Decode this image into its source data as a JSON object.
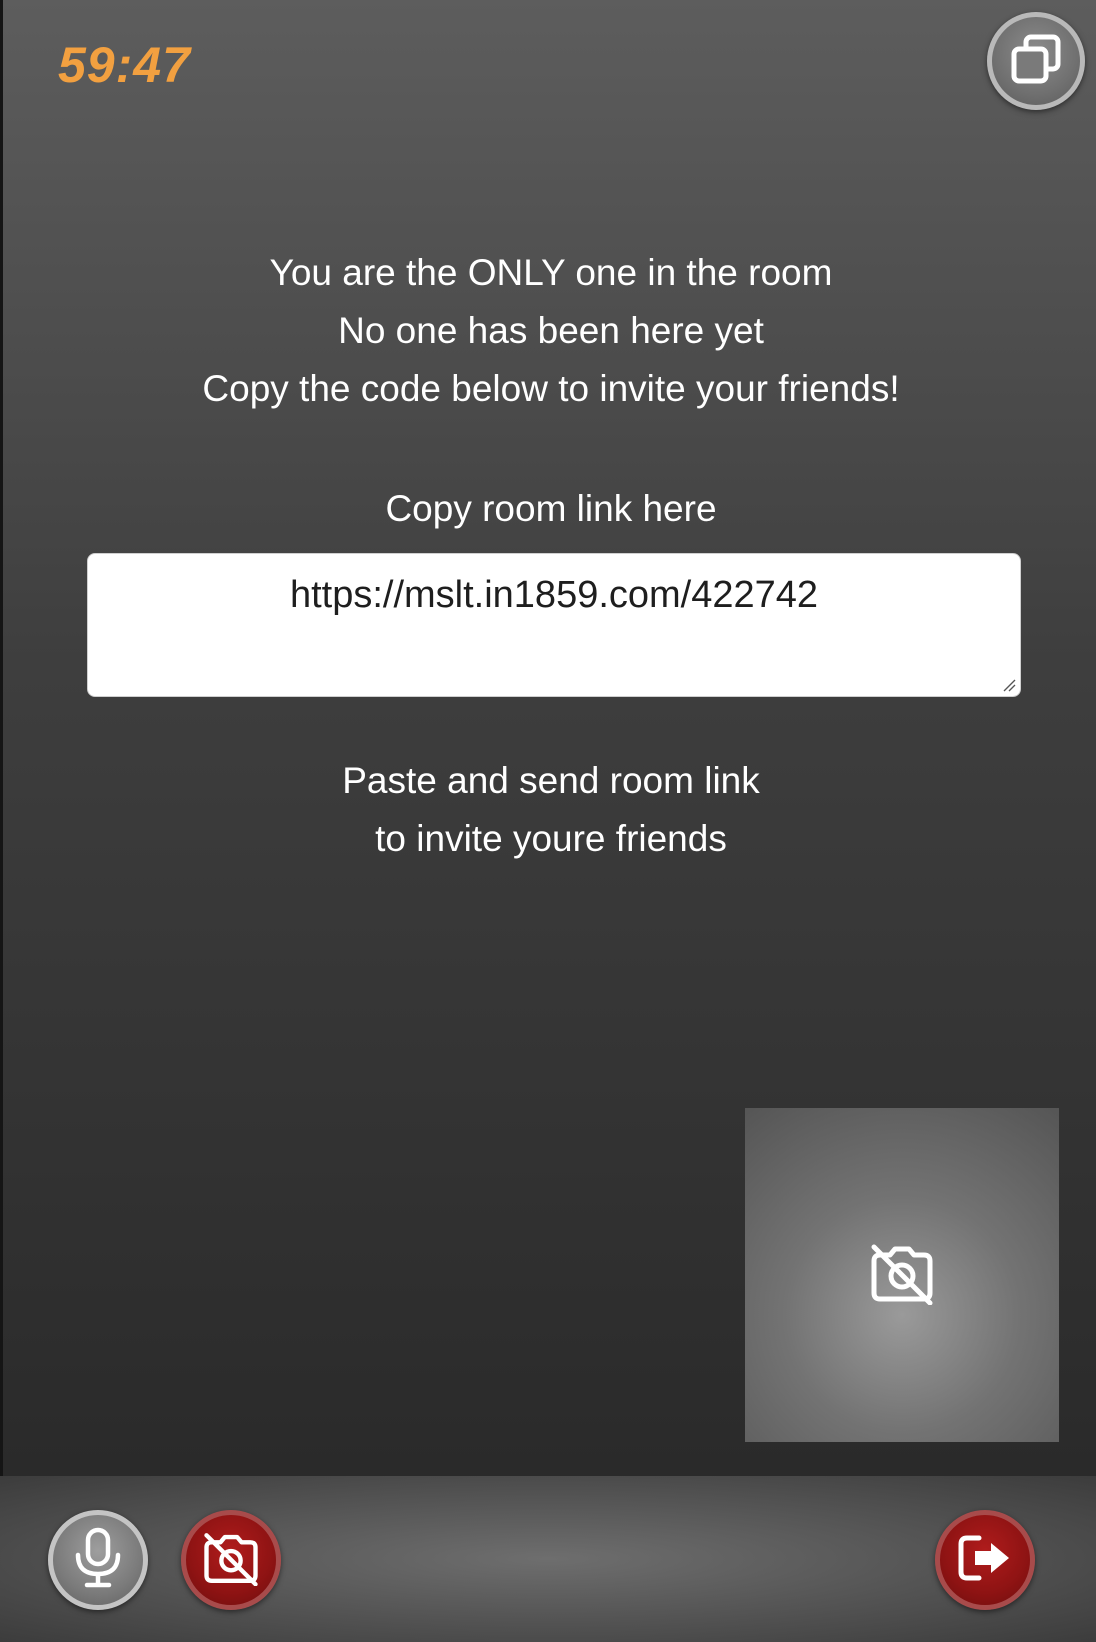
{
  "timer": "59:47",
  "icons": {
    "pip": "pip-toggle-icon",
    "camera_off": "camera-off-icon",
    "mic": "microphone-icon",
    "leave": "leave-room-icon"
  },
  "status": {
    "line1": "You are the ONLY one in the room",
    "line2": "No one has been here yet",
    "line3": "Copy the code below to invite your friends!"
  },
  "copy_label": "Copy room link here",
  "room_link": "https://mslt.in1859.com/422742",
  "paste_hint": {
    "line1": "Paste and send room link",
    "line2": "to invite youre friends"
  },
  "colors": {
    "timer": "#f2a040",
    "danger": "#8e1313",
    "neutral_button": "#7b7b7b"
  }
}
